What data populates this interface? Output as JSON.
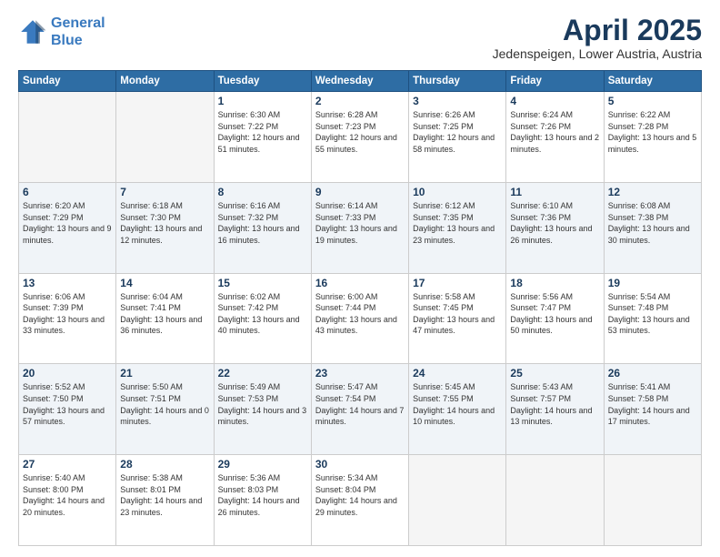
{
  "header": {
    "logo_line1": "General",
    "logo_line2": "Blue",
    "title": "April 2025",
    "subtitle": "Jedenspeigen, Lower Austria, Austria"
  },
  "days_of_week": [
    "Sunday",
    "Monday",
    "Tuesday",
    "Wednesday",
    "Thursday",
    "Friday",
    "Saturday"
  ],
  "weeks": [
    [
      {
        "day": "",
        "sunrise": "",
        "sunset": "",
        "daylight": "",
        "empty": true
      },
      {
        "day": "",
        "sunrise": "",
        "sunset": "",
        "daylight": "",
        "empty": true
      },
      {
        "day": "1",
        "sunrise": "Sunrise: 6:30 AM",
        "sunset": "Sunset: 7:22 PM",
        "daylight": "Daylight: 12 hours and 51 minutes."
      },
      {
        "day": "2",
        "sunrise": "Sunrise: 6:28 AM",
        "sunset": "Sunset: 7:23 PM",
        "daylight": "Daylight: 12 hours and 55 minutes."
      },
      {
        "day": "3",
        "sunrise": "Sunrise: 6:26 AM",
        "sunset": "Sunset: 7:25 PM",
        "daylight": "Daylight: 12 hours and 58 minutes."
      },
      {
        "day": "4",
        "sunrise": "Sunrise: 6:24 AM",
        "sunset": "Sunset: 7:26 PM",
        "daylight": "Daylight: 13 hours and 2 minutes."
      },
      {
        "day": "5",
        "sunrise": "Sunrise: 6:22 AM",
        "sunset": "Sunset: 7:28 PM",
        "daylight": "Daylight: 13 hours and 5 minutes."
      }
    ],
    [
      {
        "day": "6",
        "sunrise": "Sunrise: 6:20 AM",
        "sunset": "Sunset: 7:29 PM",
        "daylight": "Daylight: 13 hours and 9 minutes."
      },
      {
        "day": "7",
        "sunrise": "Sunrise: 6:18 AM",
        "sunset": "Sunset: 7:30 PM",
        "daylight": "Daylight: 13 hours and 12 minutes."
      },
      {
        "day": "8",
        "sunrise": "Sunrise: 6:16 AM",
        "sunset": "Sunset: 7:32 PM",
        "daylight": "Daylight: 13 hours and 16 minutes."
      },
      {
        "day": "9",
        "sunrise": "Sunrise: 6:14 AM",
        "sunset": "Sunset: 7:33 PM",
        "daylight": "Daylight: 13 hours and 19 minutes."
      },
      {
        "day": "10",
        "sunrise": "Sunrise: 6:12 AM",
        "sunset": "Sunset: 7:35 PM",
        "daylight": "Daylight: 13 hours and 23 minutes."
      },
      {
        "day": "11",
        "sunrise": "Sunrise: 6:10 AM",
        "sunset": "Sunset: 7:36 PM",
        "daylight": "Daylight: 13 hours and 26 minutes."
      },
      {
        "day": "12",
        "sunrise": "Sunrise: 6:08 AM",
        "sunset": "Sunset: 7:38 PM",
        "daylight": "Daylight: 13 hours and 30 minutes."
      }
    ],
    [
      {
        "day": "13",
        "sunrise": "Sunrise: 6:06 AM",
        "sunset": "Sunset: 7:39 PM",
        "daylight": "Daylight: 13 hours and 33 minutes."
      },
      {
        "day": "14",
        "sunrise": "Sunrise: 6:04 AM",
        "sunset": "Sunset: 7:41 PM",
        "daylight": "Daylight: 13 hours and 36 minutes."
      },
      {
        "day": "15",
        "sunrise": "Sunrise: 6:02 AM",
        "sunset": "Sunset: 7:42 PM",
        "daylight": "Daylight: 13 hours and 40 minutes."
      },
      {
        "day": "16",
        "sunrise": "Sunrise: 6:00 AM",
        "sunset": "Sunset: 7:44 PM",
        "daylight": "Daylight: 13 hours and 43 minutes."
      },
      {
        "day": "17",
        "sunrise": "Sunrise: 5:58 AM",
        "sunset": "Sunset: 7:45 PM",
        "daylight": "Daylight: 13 hours and 47 minutes."
      },
      {
        "day": "18",
        "sunrise": "Sunrise: 5:56 AM",
        "sunset": "Sunset: 7:47 PM",
        "daylight": "Daylight: 13 hours and 50 minutes."
      },
      {
        "day": "19",
        "sunrise": "Sunrise: 5:54 AM",
        "sunset": "Sunset: 7:48 PM",
        "daylight": "Daylight: 13 hours and 53 minutes."
      }
    ],
    [
      {
        "day": "20",
        "sunrise": "Sunrise: 5:52 AM",
        "sunset": "Sunset: 7:50 PM",
        "daylight": "Daylight: 13 hours and 57 minutes."
      },
      {
        "day": "21",
        "sunrise": "Sunrise: 5:50 AM",
        "sunset": "Sunset: 7:51 PM",
        "daylight": "Daylight: 14 hours and 0 minutes."
      },
      {
        "day": "22",
        "sunrise": "Sunrise: 5:49 AM",
        "sunset": "Sunset: 7:53 PM",
        "daylight": "Daylight: 14 hours and 3 minutes."
      },
      {
        "day": "23",
        "sunrise": "Sunrise: 5:47 AM",
        "sunset": "Sunset: 7:54 PM",
        "daylight": "Daylight: 14 hours and 7 minutes."
      },
      {
        "day": "24",
        "sunrise": "Sunrise: 5:45 AM",
        "sunset": "Sunset: 7:55 PM",
        "daylight": "Daylight: 14 hours and 10 minutes."
      },
      {
        "day": "25",
        "sunrise": "Sunrise: 5:43 AM",
        "sunset": "Sunset: 7:57 PM",
        "daylight": "Daylight: 14 hours and 13 minutes."
      },
      {
        "day": "26",
        "sunrise": "Sunrise: 5:41 AM",
        "sunset": "Sunset: 7:58 PM",
        "daylight": "Daylight: 14 hours and 17 minutes."
      }
    ],
    [
      {
        "day": "27",
        "sunrise": "Sunrise: 5:40 AM",
        "sunset": "Sunset: 8:00 PM",
        "daylight": "Daylight: 14 hours and 20 minutes."
      },
      {
        "day": "28",
        "sunrise": "Sunrise: 5:38 AM",
        "sunset": "Sunset: 8:01 PM",
        "daylight": "Daylight: 14 hours and 23 minutes."
      },
      {
        "day": "29",
        "sunrise": "Sunrise: 5:36 AM",
        "sunset": "Sunset: 8:03 PM",
        "daylight": "Daylight: 14 hours and 26 minutes."
      },
      {
        "day": "30",
        "sunrise": "Sunrise: 5:34 AM",
        "sunset": "Sunset: 8:04 PM",
        "daylight": "Daylight: 14 hours and 29 minutes."
      },
      {
        "day": "",
        "sunrise": "",
        "sunset": "",
        "daylight": "",
        "empty": true
      },
      {
        "day": "",
        "sunrise": "",
        "sunset": "",
        "daylight": "",
        "empty": true
      },
      {
        "day": "",
        "sunrise": "",
        "sunset": "",
        "daylight": "",
        "empty": true
      }
    ]
  ]
}
